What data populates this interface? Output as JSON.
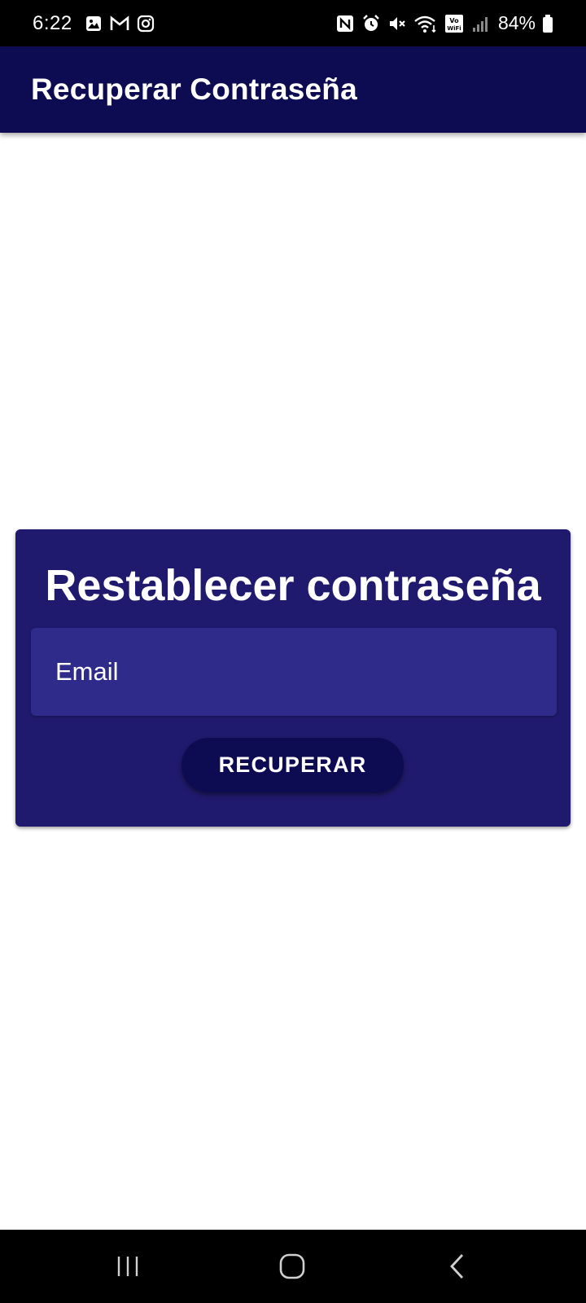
{
  "status_bar": {
    "time": "6:22",
    "battery": "84%",
    "icons_left": [
      "gallery-icon",
      "gmail-icon",
      "instagram-icon"
    ],
    "icons_right": [
      "nfc-icon",
      "alarm-icon",
      "mute-icon",
      "wifi-icon",
      "vowifi-icon",
      "signal-icon",
      "battery-icon"
    ]
  },
  "app_bar": {
    "title": "Recuperar Contraseña",
    "color": "#0d0b51"
  },
  "card": {
    "title": "Restablecer contraseña",
    "background": "#201a6e",
    "email_field": {
      "placeholder": "Email",
      "value": ""
    },
    "button_label": "RECUPERAR"
  },
  "nav_bar": {
    "buttons": [
      "recent-apps-icon",
      "home-icon",
      "back-icon"
    ]
  }
}
